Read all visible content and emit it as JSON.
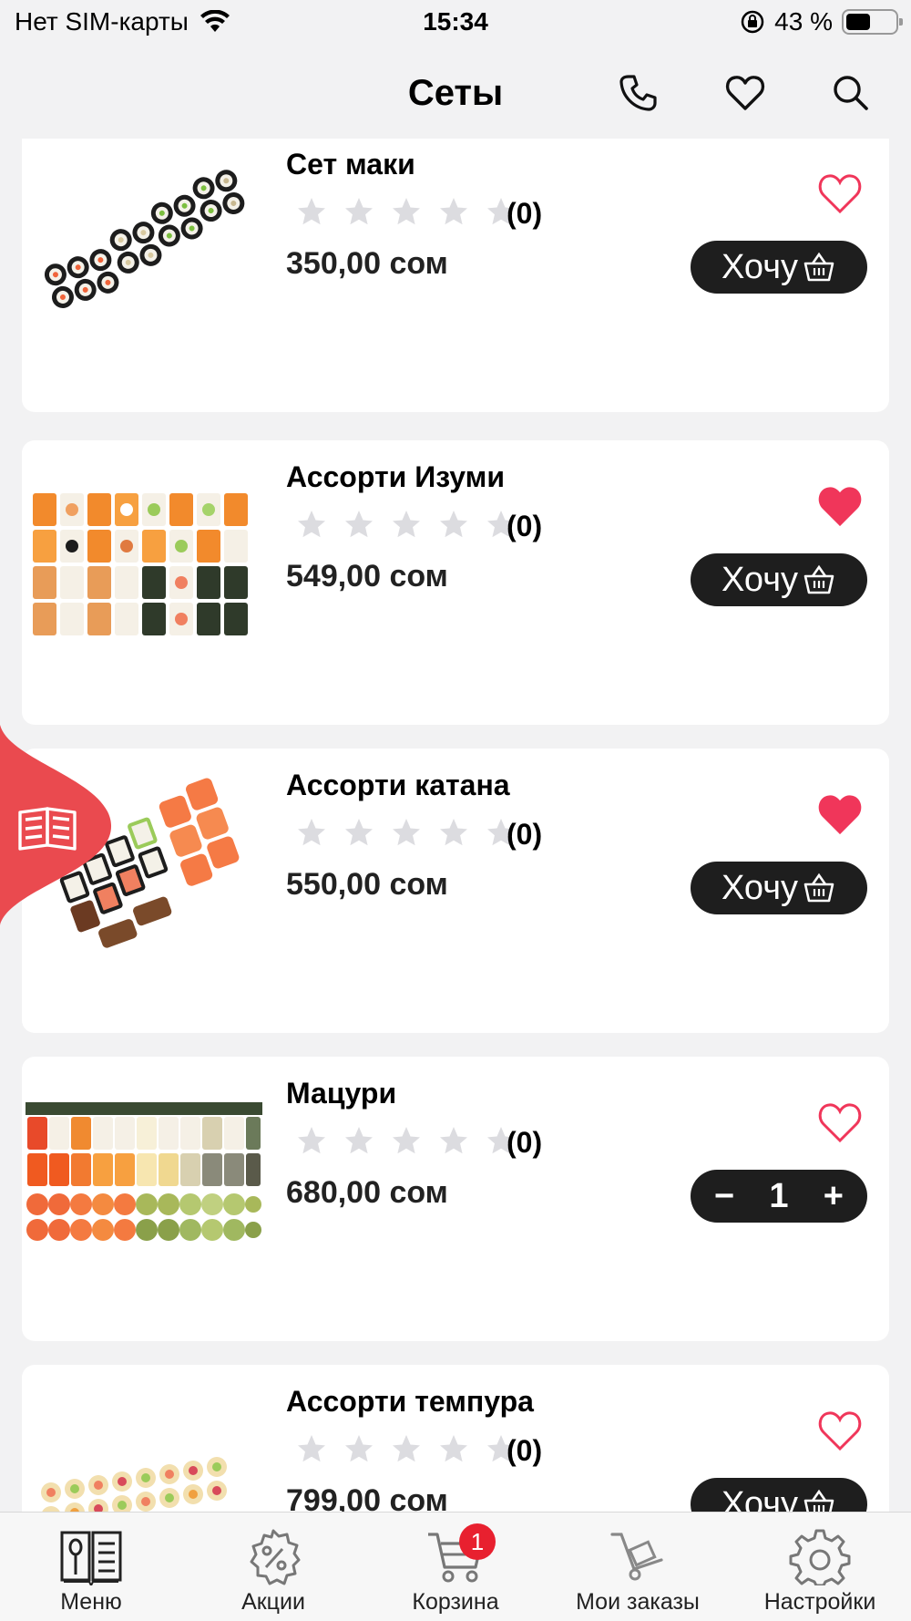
{
  "status_bar": {
    "carrier": "Нет SIM-карты",
    "time": "15:34",
    "battery": "43 %",
    "battery_level": 0.43
  },
  "header": {
    "title": "Сеты",
    "icons": [
      "phone-icon",
      "heart-icon",
      "search-icon"
    ]
  },
  "accent_colors": {
    "favorite": "#f0365a",
    "button": "#1e1e1e",
    "badge": "#e8202f",
    "float_tab": "#ea4a4f"
  },
  "products": [
    {
      "name": "Сет маки",
      "rating_count": "(0)",
      "price": "350,00 сом",
      "favorite": false,
      "action": "Хочу",
      "stars": 0
    },
    {
      "name": "Ассорти Изуми",
      "rating_count": "(0)",
      "price": "549,00 сом",
      "favorite": true,
      "action": "Хочу",
      "stars": 0
    },
    {
      "name": "Ассорти катана",
      "rating_count": "(0)",
      "price": "550,00 сом",
      "favorite": true,
      "action": "Хочу",
      "stars": 0
    },
    {
      "name": "Мацури",
      "rating_count": "(0)",
      "price": "680,00 сом",
      "favorite": false,
      "quantity": "1",
      "stars": 0
    },
    {
      "name": "Ассорти темпура",
      "rating_count": "(0)",
      "price": "799,00 сом",
      "favorite": false,
      "action": "Хочу",
      "stars": 0
    }
  ],
  "stepper": {
    "minus": "−",
    "plus": "+"
  },
  "tabbar": {
    "tabs": [
      {
        "label": "Меню",
        "icon": "menu-book-icon"
      },
      {
        "label": "Акции",
        "icon": "discount-icon"
      },
      {
        "label": "Корзина",
        "icon": "cart-icon",
        "badge": "1"
      },
      {
        "label": "Мои заказы",
        "icon": "orders-icon"
      },
      {
        "label": "Настройки",
        "icon": "settings-icon"
      }
    ]
  }
}
